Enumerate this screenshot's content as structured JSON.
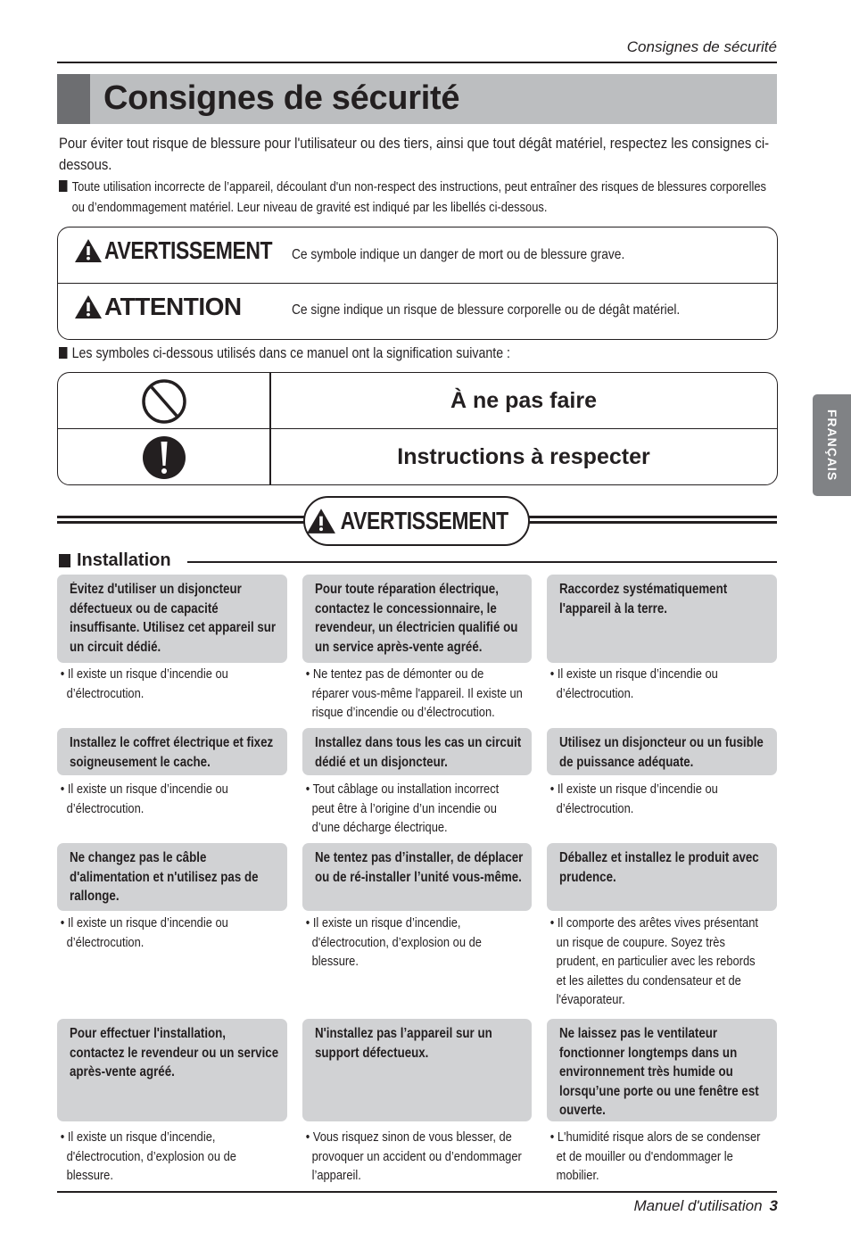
{
  "page": {
    "running_head": "Consignes de sécurité",
    "title": "Consignes de sécurité",
    "intro": "Pour éviter tout risque de blessure pour l'utilisateur ou des tiers, ainsi que tout dégât matériel, respectez les consignes ci-dessous.",
    "intro_bullet": "Toute utilisation incorrecte de l’appareil, découlant d'un non-respect des instructions, peut entraîner des risques de blessures corporelles ou d’endommagement matériel. Leur niveau de gravité est indiqué par les libellés ci-dessous.",
    "language_tab": "FRANÇAIS"
  },
  "legend": {
    "rows": [
      {
        "icon": "warning-triangle-icon",
        "label": "AVERTISSEMENT",
        "description": "Ce symbole indique un danger de mort ou de blessure grave."
      },
      {
        "icon": "warning-triangle-icon",
        "label": "ATTENTION",
        "description": "Ce signe indique un risque de blessure corporelle ou de dégât matériel."
      }
    ]
  },
  "symbols": {
    "intro": "Les symboles ci-dessous utilisés dans ce manuel ont la signification suivante :",
    "rows": [
      {
        "icon": "prohibited-icon",
        "label": "À ne pas faire"
      },
      {
        "icon": "mandatory-exclamation-icon",
        "label": "Instructions à respecter"
      }
    ]
  },
  "banner": {
    "icon": "warning-triangle-icon",
    "label": "AVERTISSEMENT"
  },
  "section": {
    "title": "Installation",
    "cards": [
      {
        "title_lines": [
          "Évitez d'utiliser un disjoncteur",
          "défectueux ou de capacité",
          "insuffisante. Utilisez cet appareil sur",
          "un circuit dédié."
        ],
        "note_lines": [
          "• Il existe un risque d’incendie ou",
          "d’électrocution."
        ]
      },
      {
        "title_lines": [
          "Pour toute réparation électrique,",
          "contactez le concessionnaire, le",
          "revendeur, un électricien qualifié ou",
          "un service après-vente agréé."
        ],
        "note_lines": [
          "• Ne tentez pas de démonter ou de",
          "réparer vous-même l'appareil. Il existe un",
          "risque d’incendie ou d’électrocution."
        ]
      },
      {
        "title_lines": [
          "Raccordez systématiquement",
          "l'appareil à la terre."
        ],
        "note_lines": [
          "• Il existe un risque d’incendie ou",
          "d’électrocution."
        ]
      },
      {
        "title_lines": [
          "Installez le coffret électrique et fixez",
          "soigneusement le cache."
        ],
        "note_lines": [
          "• Il existe un risque d’incendie ou",
          "d’électrocution."
        ]
      },
      {
        "title_lines": [
          "Installez dans tous les cas un circuit",
          "dédié et un disjoncteur."
        ],
        "note_lines": [
          "• Tout câblage ou installation incorrect",
          "peut être à l’origine d’un incendie ou",
          "d’une décharge électrique."
        ]
      },
      {
        "title_lines": [
          "Utilisez un disjoncteur ou un fusible",
          "de puissance adéquate."
        ],
        "note_lines": [
          "• Il existe un risque d’incendie ou",
          "d’électrocution."
        ]
      },
      {
        "title_lines": [
          "Ne changez pas le câble",
          "d'alimentation et n'utilisez pas de",
          "rallonge."
        ],
        "note_lines": [
          "• Il existe un risque d’incendie ou",
          "d’électrocution."
        ]
      },
      {
        "title_lines": [
          "Ne tentez pas d’installer, de déplacer",
          "ou de ré-installer l’unité vous-même."
        ],
        "note_lines": [
          "• Il existe un risque d’incendie,",
          "d'électrocution, d’explosion ou de",
          "blessure."
        ]
      },
      {
        "title_lines": [
          "Déballez et installez le produit avec",
          "prudence."
        ],
        "note_lines": [
          "• Il comporte des arêtes vives présentant",
          "un risque de coupure. Soyez très",
          "prudent, en particulier avec les rebords",
          "et les ailettes du condensateur et de",
          "l'évaporateur."
        ]
      },
      {
        "title_lines": [
          "Pour effectuer l'installation,",
          "contactez le revendeur ou un service",
          "après-vente agréé."
        ],
        "note_lines": [
          "• Il existe un risque d’incendie,",
          "d'électrocution, d’explosion ou de",
          "blessure."
        ]
      },
      {
        "title_lines": [
          "N'installez pas l’appareil sur un",
          "support défectueux."
        ],
        "note_lines": [
          "• Vous risquez sinon de vous blesser, de",
          "provoquer un accident ou d’endommager",
          "l’appareil."
        ]
      },
      {
        "title_lines": [
          "Ne laissez pas le ventilateur",
          "fonctionner longtemps dans un",
          "environnement très humide ou",
          "lorsqu’une porte ou une fenêtre est",
          "ouverte."
        ],
        "note_lines": [
          "• L'humidité risque alors de se condenser",
          "et de mouiller ou d'endommager le",
          "mobilier."
        ]
      }
    ]
  },
  "footer": {
    "label": "Manuel d'utilisation",
    "page_number": "3"
  }
}
